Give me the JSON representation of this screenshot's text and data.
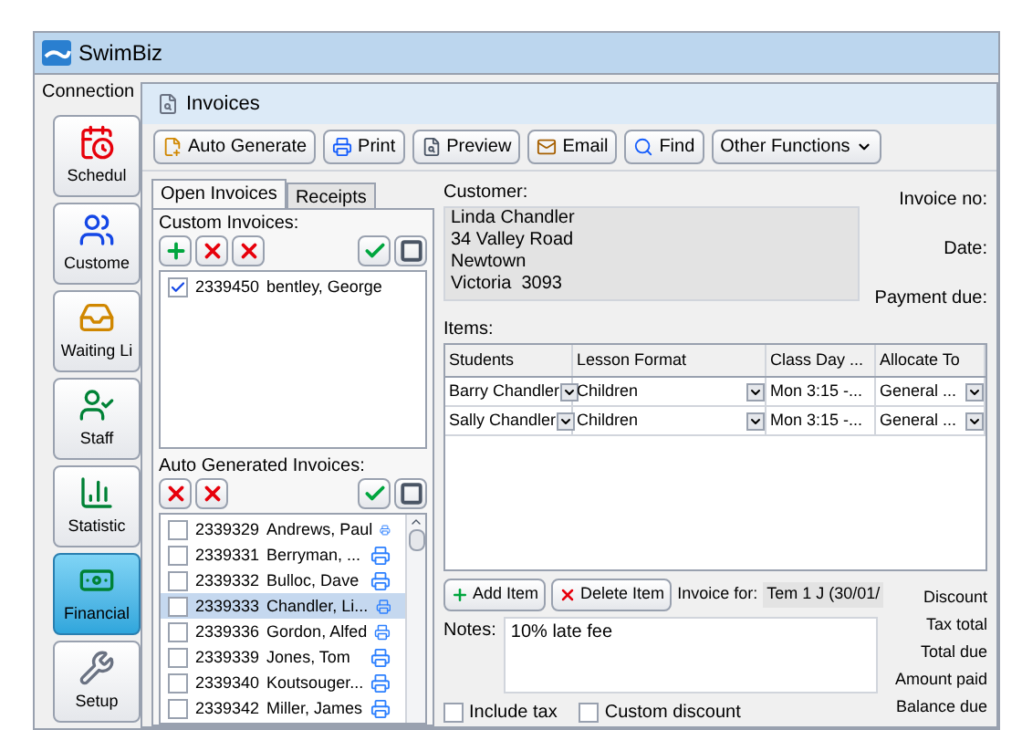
{
  "app": {
    "title": "SwimBiz",
    "menu": [
      "Connection"
    ],
    "nav": [
      {
        "label": "Schedul",
        "selected": false
      },
      {
        "label": "Custome",
        "selected": false
      },
      {
        "label": "Waiting Li",
        "selected": false
      },
      {
        "label": "Staff",
        "selected": false
      },
      {
        "label": "Statistic",
        "selected": false
      },
      {
        "label": "Financial",
        "selected": true
      },
      {
        "label": "Setup",
        "selected": false
      }
    ]
  },
  "invoices": {
    "title": "Invoices",
    "toolbar": [
      {
        "label": "Auto Generate",
        "kind": "button"
      },
      {
        "label": "Print",
        "kind": "button"
      },
      {
        "label": "Preview",
        "kind": "button"
      },
      {
        "label": "Email",
        "kind": "button"
      },
      {
        "label": "Find",
        "kind": "button"
      },
      {
        "label": "Other Functions",
        "kind": "dropdown"
      }
    ],
    "tabs": [
      {
        "label": "Open Invoices",
        "selected": true
      },
      {
        "label": "Receipts",
        "selected": false
      }
    ],
    "custom_invoices": {
      "label": "Custom Invoices:",
      "rows": [
        {
          "number": "2339450",
          "name": "bentley, George",
          "checked": true,
          "selected": false
        }
      ]
    },
    "auto_invoices": {
      "label": "Auto Generated Invoices:",
      "rows": [
        {
          "number": "2339329",
          "name": "Andrews, Paul",
          "checked": false,
          "selected": false
        },
        {
          "number": "2339331",
          "name": "Berryman, ...",
          "checked": false,
          "selected": false
        },
        {
          "number": "2339332",
          "name": "Bulloc, Dave",
          "checked": false,
          "selected": false
        },
        {
          "number": "2339333",
          "name": "Chandler, Li...",
          "checked": false,
          "selected": true
        },
        {
          "number": "2339336",
          "name": "Gordon, Alfed",
          "checked": false,
          "selected": false
        },
        {
          "number": "2339339",
          "name": "Jones, Tom",
          "checked": false,
          "selected": false
        },
        {
          "number": "2339340",
          "name": "Koutsouger...",
          "checked": false,
          "selected": false
        },
        {
          "number": "2339342",
          "name": "Miller, James",
          "checked": false,
          "selected": false
        }
      ]
    },
    "customer": {
      "label": "Customer:",
      "address": [
        "Linda Chandler",
        "34 Valley Road",
        "Newtown",
        "Victoria  3093"
      ]
    },
    "invoice_fields": [
      "Invoice no:",
      "Date:",
      "Payment due:"
    ],
    "items": {
      "label": "Items:",
      "columns": [
        {
          "label": "Students",
          "kind": "dropdown"
        },
        {
          "label": "Lesson Format",
          "kind": "dropdown"
        },
        {
          "label": "Class Day ...",
          "kind": "text"
        },
        {
          "label": "Allocate To",
          "kind": "dropdown"
        }
      ],
      "rows": [
        [
          "Barry Chandler",
          "Children",
          "Mon 3:15 -...",
          "General ..."
        ],
        [
          "Sally Chandler",
          "Children",
          "Mon 3:15 -...",
          "General ..."
        ]
      ]
    },
    "item_buttons": [
      {
        "label": "Add Item",
        "kind": "add"
      },
      {
        "label": "Delete Item",
        "kind": "delete"
      }
    ],
    "invoice_for": {
      "label": "Invoice for:",
      "value": "Tem 1 J (30/01/"
    },
    "notes": {
      "label": "Notes:",
      "value": "10% late fee"
    },
    "options": [
      {
        "label": "Include tax",
        "checked": false
      },
      {
        "label": "Custom discount",
        "checked": false
      }
    ],
    "totals": [
      "Discount",
      "Tax total",
      "Total due",
      "Amount paid",
      "Balance due"
    ]
  }
}
